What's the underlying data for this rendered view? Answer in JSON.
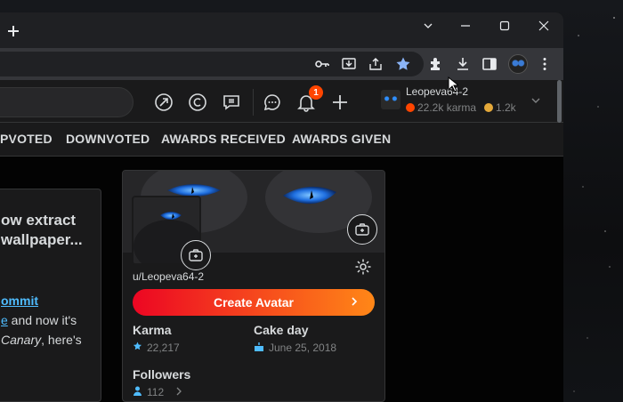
{
  "browser": {
    "new_tab_icon": "plus-icon",
    "window_controls": [
      "chevron-down-icon",
      "minimize-icon",
      "maximize-icon",
      "close-icon"
    ],
    "toolbar_icons": [
      "key-icon",
      "install-app-icon",
      "share-icon",
      "bookmark-star-icon",
      "extensions-icon",
      "download-icon",
      "side-panel-icon",
      "profile-avatar",
      "menu-icon"
    ],
    "accent": "#8ab4f8"
  },
  "header": {
    "icons": [
      "popular-icon",
      "coins-icon",
      "mod-icon",
      "chat-icon",
      "notifications-icon",
      "create-post-icon"
    ],
    "notification_count": "1",
    "user": {
      "name": "Leopeva64-2",
      "karma": "22.2k karma",
      "coins": "1.2k"
    }
  },
  "tabs": [
    "PVOTED",
    "DOWNVOTED",
    "AWARDS RECEIVED",
    "AWARDS GIVEN"
  ],
  "post": {
    "title": "ow extract wallpaper...",
    "link1": "ommit",
    "link2": "e",
    "text1": " and now it's",
    "text2_italic": "Canary",
    "text2": ", here's"
  },
  "profile": {
    "username": "u/Leopeva64-2",
    "create_avatar_label": "Create Avatar",
    "karma_label": "Karma",
    "karma_value": "22,217",
    "cakeday_label": "Cake day",
    "cakeday_value": "June 25, 2018",
    "followers_label": "Followers",
    "followers_value": "112",
    "brand_gradient": [
      "#ec0623",
      "#ff8717"
    ],
    "link_color": "#4fbcff"
  }
}
